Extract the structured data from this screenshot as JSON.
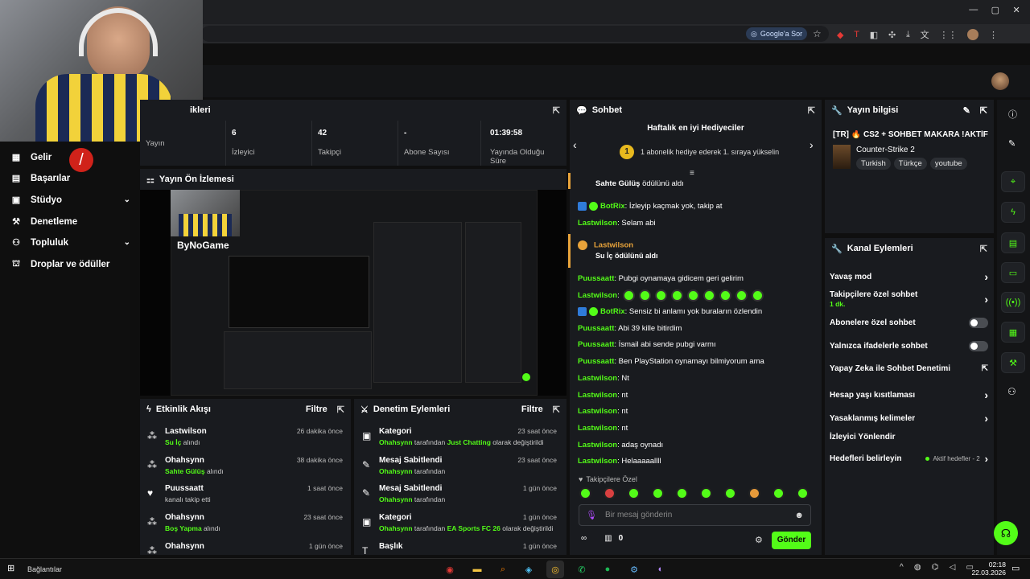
{
  "browser": {
    "google_button": "Google'a Sor"
  },
  "sidebar": {
    "items": [
      {
        "label": "Gelir",
        "icon": "income-icon"
      },
      {
        "label": "Başarılar",
        "icon": "achievements-icon"
      },
      {
        "label": "Stüdyo",
        "icon": "studio-icon",
        "expand": true
      },
      {
        "label": "Denetleme",
        "icon": "moderation-icon"
      },
      {
        "label": "Topluluk",
        "icon": "community-icon",
        "expand": true
      },
      {
        "label": "Droplar ve ödüller",
        "icon": "drops-icon"
      }
    ]
  },
  "stats": {
    "header": "ikleri",
    "items": [
      {
        "value": "",
        "label": "Yayın"
      },
      {
        "value": "6",
        "label": "İzleyici"
      },
      {
        "value": "42",
        "label": "Takipçi"
      },
      {
        "value": "-",
        "label": "Abone Sayısı"
      },
      {
        "value": "01:39:58",
        "label": "Yayında Olduğu Süre"
      }
    ]
  },
  "preview": {
    "title": "Yayın Ön İzlemesi",
    "brand": "ByNoGame"
  },
  "activity": {
    "title": "Etkinlik Akışı",
    "filter": "Filtre",
    "items": [
      {
        "user": "Lastwilson",
        "highlight": "Su İç",
        "suffix": " alındı",
        "time": "26 dakika önce",
        "icon": "gift-icon"
      },
      {
        "user": "Ohahsynn",
        "highlight": "Sahte Gülüş",
        "suffix": " alındı",
        "time": "38 dakika önce",
        "icon": "gift-icon"
      },
      {
        "user": "Puussaatt",
        "highlight": "",
        "suffix": "kanalı takip etti",
        "time": "1 saat önce",
        "icon": "heart-icon"
      },
      {
        "user": "Ohahsynn",
        "highlight": "Boş Yapma",
        "suffix": " alındı",
        "time": "23 saat önce",
        "icon": "gift-icon"
      },
      {
        "user": "Ohahsynn",
        "highlight": "",
        "suffix": "",
        "time": "1 gün önce",
        "icon": "gift-icon"
      }
    ]
  },
  "moderation": {
    "title": "Denetim Eylemleri",
    "filter": "Filtre",
    "items": [
      {
        "title": "Kategori",
        "user": "Ohahsynn",
        "mid": " tarafından ",
        "hl": "Just Chatting",
        "end": " olarak değiştirildi",
        "time": "23 saat önce",
        "icon": "category-icon"
      },
      {
        "title": "Mesaj Sabitlendi",
        "user": "Ohahsynn",
        "mid": " tarafından",
        "hl": "",
        "end": "",
        "time": "23 saat önce",
        "icon": "pin-icon"
      },
      {
        "title": "Mesaj Sabitlendi",
        "user": "Ohahsynn",
        "mid": " tarafından",
        "hl": "",
        "end": "",
        "time": "1 gün önce",
        "icon": "pin-icon"
      },
      {
        "title": "Kategori",
        "user": "Ohahsynn",
        "mid": " tarafından ",
        "hl": "EA Sports FC 26",
        "end": " olarak değiştirildi",
        "time": "1 gün önce",
        "icon": "category-icon"
      },
      {
        "title": "Başlık",
        "user": "",
        "mid": "",
        "hl": "",
        "end": "",
        "time": "1 gün önce",
        "icon": "title-icon"
      }
    ]
  },
  "chat": {
    "title": "Sohbet",
    "gifters_title": "Haftalık en iyi Hediyeciler",
    "gifters_rank": "1",
    "gifters_text": "1 abonelik hediye ederek 1. sıraya yükselin",
    "messages": [
      {
        "user": "Sahte Gülüş",
        "text": " ödülünü aldı",
        "kind": "reward-tail"
      },
      {
        "user": "BotRix",
        "text": ": İzleyip kaçmak yok, takip at",
        "kind": "bot"
      },
      {
        "user": "Lastwilson",
        "text": ": Selam abi",
        "kind": "msg"
      },
      {
        "user": "Lastwilson",
        "text": "Su İç ödülünü aldı",
        "kind": "reward"
      },
      {
        "user": "Puussaatt",
        "text": ": Pubgi oynamaya gidicem geri gelirim",
        "kind": "msg"
      },
      {
        "user": "Lastwilson",
        "text": ":",
        "kind": "emotes"
      },
      {
        "user": "BotRix",
        "text": ": Sensiz bi anlamı yok buraların özlendin",
        "kind": "bot"
      },
      {
        "user": "Puussaatt",
        "text": ": Abi 39 kille bitirdim",
        "kind": "msg"
      },
      {
        "user": "Puussaatt",
        "text": ": İsmail abi sende pubgi varmı",
        "kind": "msg"
      },
      {
        "user": "Puussaatt",
        "text": ": Ben PlayStation oynamayı bilmiyorum ama",
        "kind": "msg"
      },
      {
        "user": "Lastwilson",
        "text": ": Nt",
        "kind": "msg"
      },
      {
        "user": "Lastwilson",
        "text": ": nt",
        "kind": "msg"
      },
      {
        "user": "Lastwilson",
        "text": ": nt",
        "kind": "msg"
      },
      {
        "user": "Lastwilson",
        "text": ": nt",
        "kind": "msg"
      },
      {
        "user": "Lastwilson",
        "text": ": adaş oynadı",
        "kind": "msg"
      },
      {
        "user": "Lastwilson",
        "text": ": Helaaaaallll",
        "kind": "msg"
      }
    ],
    "followers_only": "Takipçilere Özel",
    "input_placeholder": "Bir mesaj gönderin",
    "points": "0",
    "send": "Gönder"
  },
  "stream_info": {
    "title": "Yayın bilgisi",
    "stream_title": "[TR] 🔥 CS2 + SOHBET MAKARA !AKTİF",
    "game": "Counter-Strike 2",
    "tags": [
      "Turkish",
      "Türkçe",
      "youtube"
    ]
  },
  "channel_actions": {
    "title": "Kanal Eylemleri",
    "items": [
      {
        "label": "Yavaş mod",
        "control": "chevron",
        "sub": ""
      },
      {
        "label": "Takipçilere özel sohbet",
        "control": "chevron",
        "sub": "1 dk."
      },
      {
        "label": "Abonelere özel sohbet",
        "control": "toggle",
        "sub": ""
      },
      {
        "label": "Yalnızca ifadelerle sohbet",
        "control": "toggle",
        "sub": ""
      },
      {
        "label": "Yapay Zeka ile Sohbet Denetimi",
        "control": "external",
        "sub": ""
      },
      {
        "label": "Hesap yaşı kısıtlaması",
        "control": "chevron",
        "sub": ""
      },
      {
        "label": "Yasaklanmış kelimeler",
        "control": "chevron",
        "sub": ""
      },
      {
        "label": "İzleyici Yönlendir",
        "control": "none",
        "sub": ""
      },
      {
        "label": "Hedefleri belirleyin",
        "control": "chevron",
        "sub": "Aktif hedefler - 2"
      }
    ]
  },
  "taskbar": {
    "start_label": "Bağlantılar",
    "time": "02:18",
    "date": "22.03.2026"
  },
  "colors": {
    "accent": "#53fc18",
    "panel": "#191b1f",
    "bg": "#0f0f0f"
  }
}
